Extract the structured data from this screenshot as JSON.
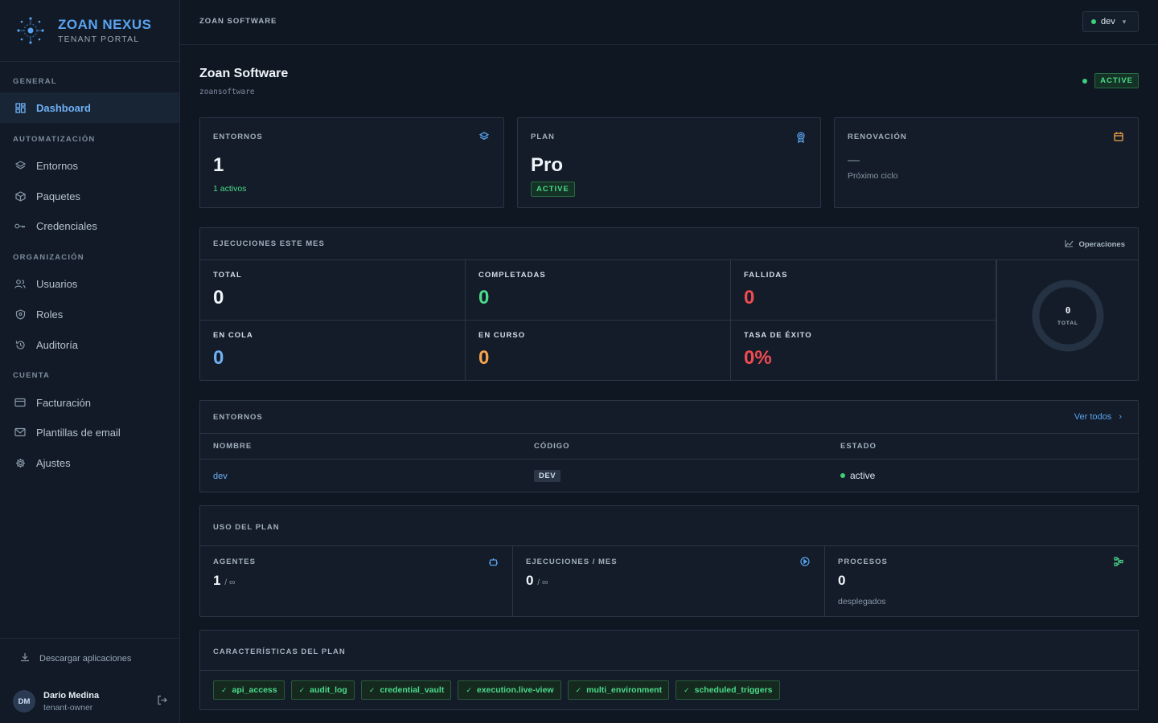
{
  "brand": {
    "name": "ZOAN NEXUS",
    "subtitle": "TENANT PORTAL"
  },
  "sidebar": {
    "sections": [
      "GENERAL",
      "AUTOMATIZACIÓN",
      "ORGANIZACIÓN",
      "CUENTA"
    ],
    "items": [
      {
        "label": "Dashboard",
        "icon": "dashboard-icon",
        "active": true
      },
      {
        "label": "Entornos",
        "icon": "layers-icon"
      },
      {
        "label": "Paquetes",
        "icon": "package-icon"
      },
      {
        "label": "Credenciales",
        "icon": "key-icon"
      },
      {
        "label": "Usuarios",
        "icon": "users-icon"
      },
      {
        "label": "Roles",
        "icon": "shield-icon"
      },
      {
        "label": "Auditoría",
        "icon": "history-icon"
      },
      {
        "label": "Facturación",
        "icon": "credit-card-icon"
      },
      {
        "label": "Plantillas de email",
        "icon": "mail-icon"
      },
      {
        "label": "Ajustes",
        "icon": "gear-icon"
      }
    ],
    "download_label": "Descargar aplicaciones",
    "user": {
      "initials": "DM",
      "name": "Dario Medina",
      "role": "tenant-owner"
    }
  },
  "topbar": {
    "breadcrumb": "ZOAN SOFTWARE",
    "env_selected": "dev"
  },
  "tenant": {
    "title": "Zoan Software",
    "slug": "zoansoftware",
    "status": "ACTIVE"
  },
  "stats": {
    "entornos": {
      "label": "ENTORNOS",
      "value": "1",
      "sub": "1 activos"
    },
    "plan": {
      "label": "PLAN",
      "value": "Pro",
      "badge": "ACTIVE"
    },
    "renovacion": {
      "label": "RENOVACIÓN",
      "value": "—",
      "sub": "Próximo ciclo"
    }
  },
  "executions": {
    "title": "EJECUCIONES ESTE MES",
    "link": "Operaciones",
    "metrics": [
      {
        "label": "TOTAL",
        "value": "0",
        "color": "#f0f5fa"
      },
      {
        "label": "COMPLETADAS",
        "value": "0",
        "color": "#4bdb8a"
      },
      {
        "label": "FALLIDAS",
        "value": "0",
        "color": "#f04b52"
      },
      {
        "label": "EN COLA",
        "value": "0",
        "color": "#6fb0f5"
      },
      {
        "label": "EN CURSO",
        "value": "0",
        "color": "#f5a34b"
      },
      {
        "label": "TASA DE ÉXITO",
        "value": "0%",
        "color": "#f04b52"
      }
    ],
    "ring": {
      "value": "0",
      "label": "TOTAL"
    }
  },
  "environments": {
    "title": "ENTORNOS",
    "see_all": "Ver todos",
    "columns": [
      "NOMBRE",
      "CÓDIGO",
      "ESTADO"
    ],
    "rows": [
      {
        "name": "dev",
        "code": "DEV",
        "state": "active"
      }
    ]
  },
  "usage": {
    "title": "USO DEL PLAN",
    "items": [
      {
        "label": "AGENTES",
        "value": "1",
        "limit": "/ ∞",
        "icon": "robot-icon"
      },
      {
        "label": "EJECUCIONES / MES",
        "value": "0",
        "limit": "/ ∞",
        "icon": "play-circle-icon"
      },
      {
        "label": "PROCESOS",
        "value": "0",
        "sub": "desplegados",
        "icon": "workflow-icon"
      }
    ]
  },
  "features": {
    "title": "CARACTERÍSTICAS DEL PLAN",
    "items": [
      "api_access",
      "audit_log",
      "credential_vault",
      "execution.live-view",
      "multi_environment",
      "scheduled_triggers"
    ]
  }
}
